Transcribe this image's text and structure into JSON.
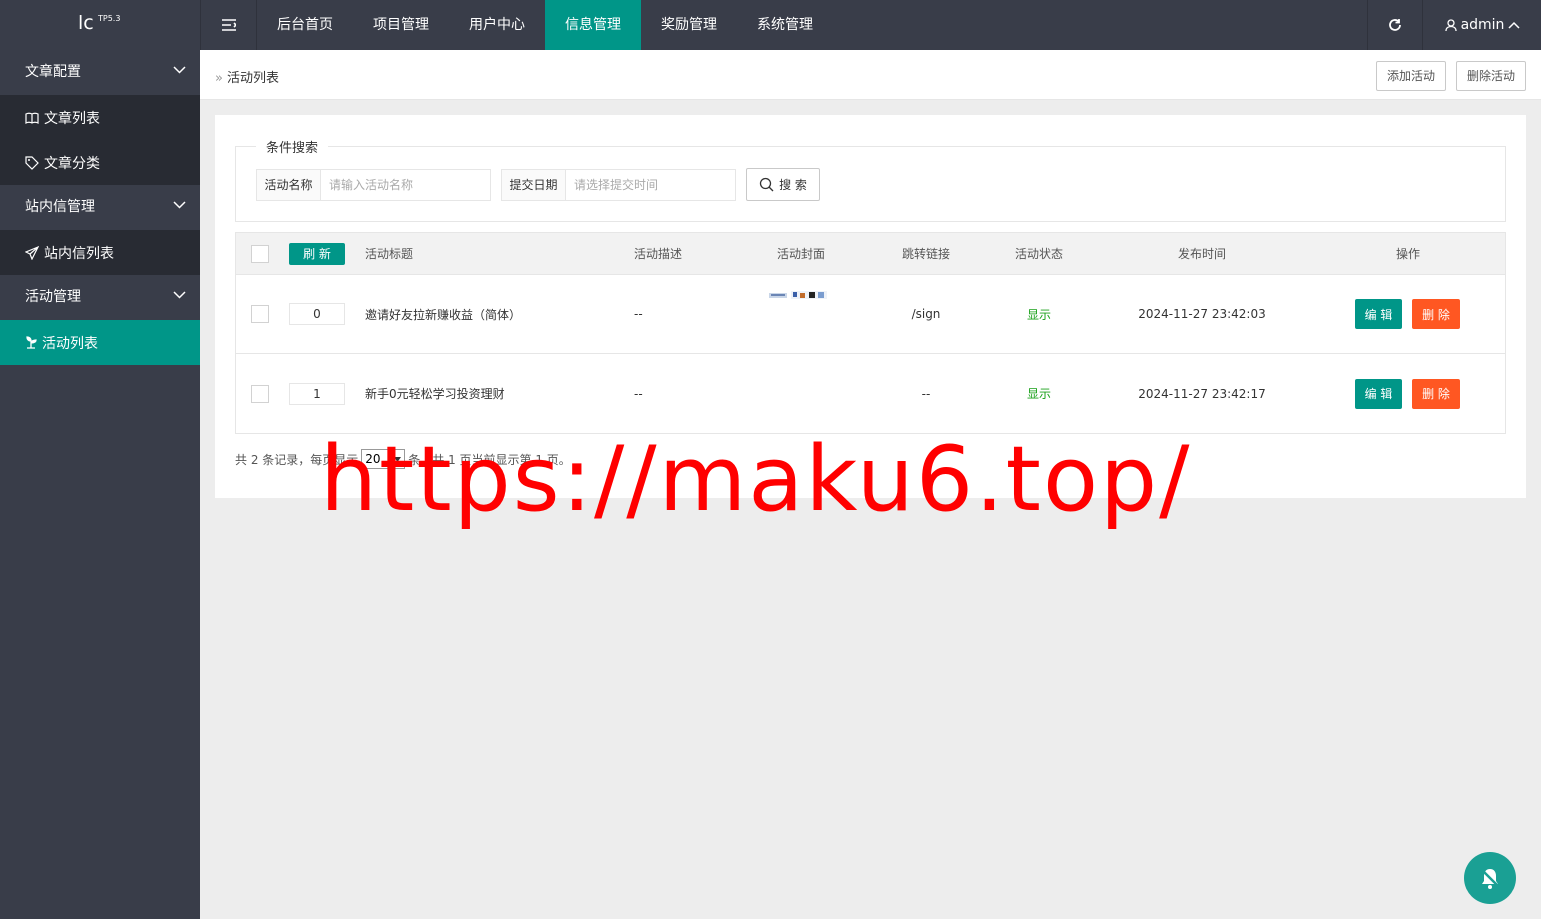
{
  "logo": {
    "text": "lc",
    "version": "TP5.3"
  },
  "topnav": {
    "items": [
      {
        "label": "后台首页"
      },
      {
        "label": "项目管理"
      },
      {
        "label": "用户中心"
      },
      {
        "label": "信息管理",
        "active": true
      },
      {
        "label": "奖励管理"
      },
      {
        "label": "系统管理"
      }
    ],
    "user": "admin"
  },
  "sidebar": {
    "group1": "文章配置",
    "item1": "文章列表",
    "item2": "文章分类",
    "group2": "站内信管理",
    "item3": "站内信列表",
    "group3": "活动管理",
    "item4": "活动列表"
  },
  "breadcrumb": {
    "current": "活动列表"
  },
  "toolbar": {
    "add": "添加活动",
    "delete": "删除活动"
  },
  "search": {
    "legend": "条件搜索",
    "name_label": "活动名称",
    "name_placeholder": "请输入活动名称",
    "date_label": "提交日期",
    "date_placeholder": "请选择提交时间",
    "button": "搜 索"
  },
  "table": {
    "refresh": "刷 新",
    "headers": {
      "title": "活动标题",
      "desc": "活动描述",
      "cover": "活动封面",
      "link": "跳转链接",
      "status": "活动状态",
      "time": "发布时间",
      "ops": "操作"
    },
    "rows": [
      {
        "sort": "0",
        "title": "邀请好友拉新赚收益（简体）",
        "desc": "--",
        "link": "/sign",
        "status": "显示",
        "time": "2024-11-27 23:42:03",
        "edit": "编 辑",
        "del": "删 除"
      },
      {
        "sort": "1",
        "title": "新手0元轻松学习投资理财",
        "desc": "--",
        "link": "--",
        "status": "显示",
        "time": "2024-11-27 23:42:17",
        "edit": "编 辑",
        "del": "删 除"
      }
    ]
  },
  "pager": {
    "prefix": "共 2 条记录，每页显示",
    "per_page": "20",
    "suffix": "条，共 1 页当前显示第 1 页。"
  },
  "watermark": "https://maku6.top/",
  "colors": {
    "primary": "#009688",
    "danger": "#ff5722",
    "dark": "#393d49"
  }
}
